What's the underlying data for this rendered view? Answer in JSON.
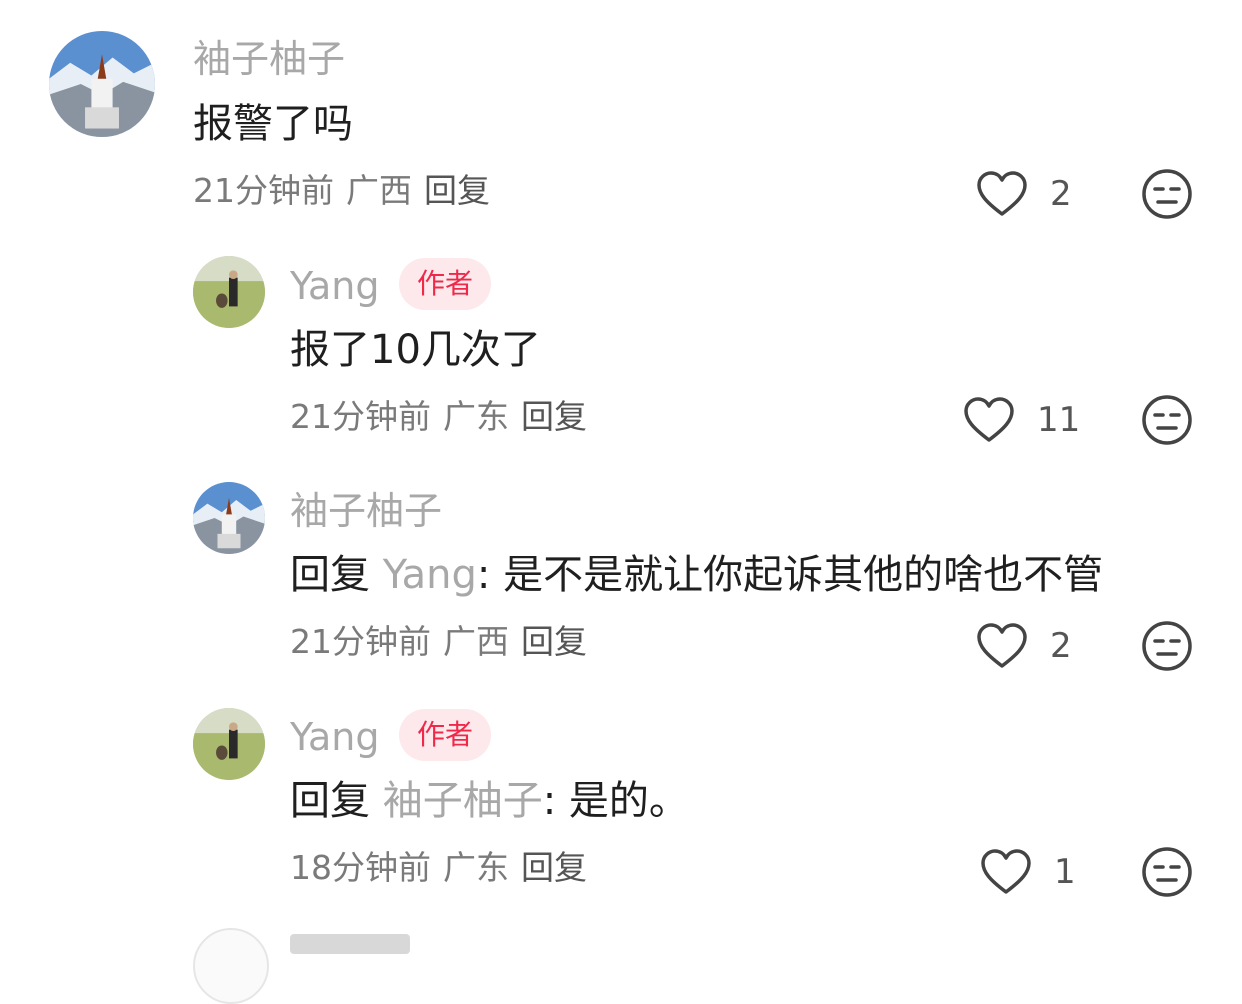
{
  "comments": [
    {
      "name": "袖子柚子",
      "badge": "",
      "reply_prefix": "",
      "reply_to": "",
      "text": "报警了吗",
      "time": "21分钟前",
      "region": "广西",
      "reply_label": "回复",
      "likes": "2"
    },
    {
      "name": "Yang",
      "badge": "作者",
      "reply_prefix": "",
      "reply_to": "",
      "text": "报了10几次了",
      "time": "21分钟前",
      "region": "广东",
      "reply_label": "回复",
      "likes": "11"
    },
    {
      "name": "袖子柚子",
      "badge": "",
      "reply_prefix": "回复 ",
      "reply_to": "Yang",
      "text": ": 是不是就让你起诉其他的啥也不管",
      "time": "21分钟前",
      "region": "广西",
      "reply_label": "回复",
      "likes": "2"
    },
    {
      "name": "Yang",
      "badge": "作者",
      "reply_prefix": "回复 ",
      "reply_to": "袖子柚子",
      "text": ": 是的。",
      "time": "18分钟前",
      "region": "广东",
      "reply_label": "回复",
      "likes": "1"
    }
  ],
  "icons": {
    "like": "heart-outline-icon",
    "dislike": "neutral-face-icon"
  },
  "colors": {
    "name": "#a8a8a8",
    "badge_text": "#f0284a",
    "badge_bg": "#fde8ec",
    "content": "#1f1f1f",
    "meta": "#7a7a7a"
  }
}
